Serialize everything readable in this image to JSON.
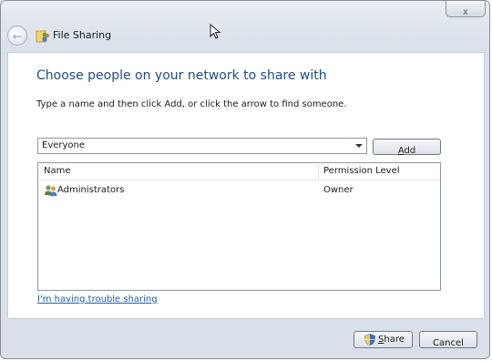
{
  "window": {
    "title": "File Sharing",
    "close_glyph": "x",
    "back_glyph": "←"
  },
  "main": {
    "heading": "Choose people on your network to share with",
    "instruction": "Type a name and then click Add, or click the arrow to find someone.",
    "combo_value": "Everyone",
    "add_label_mnemonic": "A",
    "add_label_rest": "dd",
    "columns": {
      "name": "Name",
      "permission": "Permission Level"
    },
    "rows": [
      {
        "name": "Administrators",
        "permission": "Owner",
        "icon": "users-group-icon"
      }
    ],
    "trouble_link": "I'm having trouble sharing"
  },
  "footer": {
    "share_label_mnemonic": "S",
    "share_label_rest": "hare",
    "cancel_label": "Cancel"
  },
  "colors": {
    "heading": "#1e4c88",
    "link": "#1f5fa5",
    "chrome": "#dfe5ed"
  }
}
